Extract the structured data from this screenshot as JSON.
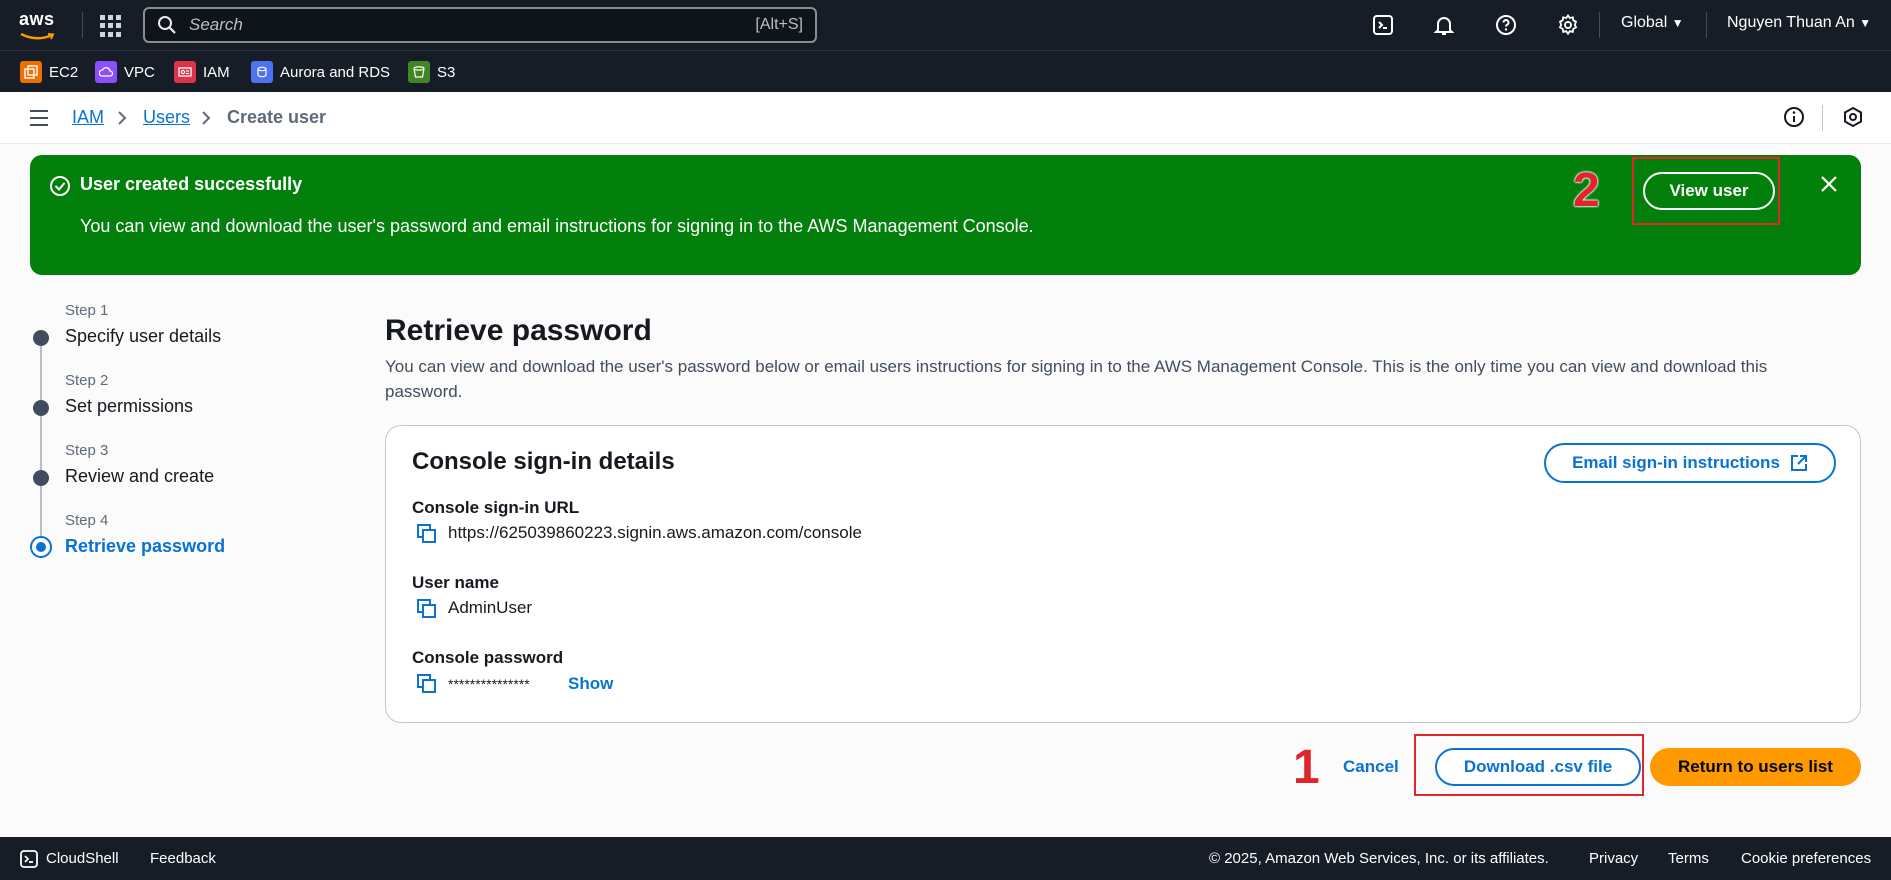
{
  "topnav": {
    "logo_text": "aws",
    "search_placeholder": "Search",
    "search_shortcut": "[Alt+S]",
    "region": "Global",
    "user": "Nguyen Thuan An"
  },
  "services": [
    {
      "label": "EC2",
      "color": "#ed7100"
    },
    {
      "label": "VPC",
      "color": "#8c4fff"
    },
    {
      "label": "IAM",
      "color": "#dd344c"
    },
    {
      "label": "Aurora and RDS",
      "color": "#4d72f3"
    },
    {
      "label": "S3",
      "color": "#3f8624"
    }
  ],
  "breadcrumb": {
    "items": [
      "IAM",
      "Users",
      "Create user"
    ]
  },
  "flash": {
    "header": "User created successfully",
    "message": "You can view and download the user's password and email instructions for signing in to the AWS Management Console.",
    "view_user_label": "View user",
    "color": "#037f0c"
  },
  "steps": [
    {
      "label": "Step 1",
      "title": "Specify user details"
    },
    {
      "label": "Step 2",
      "title": "Set permissions"
    },
    {
      "label": "Step 3",
      "title": "Review and create"
    },
    {
      "label": "Step 4",
      "title": "Retrieve password"
    }
  ],
  "main": {
    "title": "Retrieve password",
    "description": "You can view and download the user's password below or email users instructions for signing in to the AWS Management Console. This is the only time you can view and download this password.",
    "card": {
      "title": "Console sign-in details",
      "email_button": "Email sign-in instructions",
      "url_label": "Console sign-in URL",
      "url_value": "https://625039860223.signin.aws.amazon.com/console",
      "username_label": "User name",
      "username_value": "AdminUser",
      "password_label": "Console password",
      "password_value": "***************",
      "show_label": "Show"
    }
  },
  "actions": {
    "cancel": "Cancel",
    "download": "Download .csv file",
    "return": "Return to users list"
  },
  "annotations": [
    "1",
    "2"
  ],
  "footer": {
    "cloudshell": "CloudShell",
    "feedback": "Feedback",
    "copyright": "© 2025, Amazon Web Services, Inc. or its affiliates.",
    "privacy": "Privacy",
    "terms": "Terms",
    "cookies": "Cookie preferences"
  }
}
